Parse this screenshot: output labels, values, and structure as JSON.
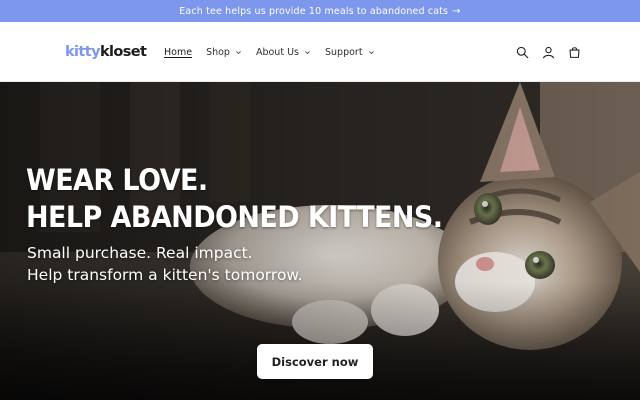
{
  "announcement": {
    "text": "Each tee helps us provide 10 meals to abandoned cats",
    "arrow": "→"
  },
  "header": {
    "logo": {
      "part1": "kitty",
      "part2": "kloset"
    },
    "nav": [
      {
        "label": "Home",
        "active": true,
        "dropdown": false
      },
      {
        "label": "Shop",
        "active": false,
        "dropdown": true
      },
      {
        "label": "About Us",
        "active": false,
        "dropdown": true
      },
      {
        "label": "Support",
        "active": false,
        "dropdown": true
      }
    ],
    "icons": [
      "search-icon",
      "account-icon",
      "cart-icon"
    ]
  },
  "hero": {
    "headline_line1": "WEAR LOVE.",
    "headline_line2": "HELP ABANDONED KITTENS.",
    "subline_line1": "Small purchase. Real impact.",
    "subline_line2": "Help transform a kitten's tomorrow.",
    "cta_label": "Discover now"
  },
  "colors": {
    "accent": "#7d97ed",
    "text_dark": "#1c1c1c",
    "white": "#ffffff"
  }
}
